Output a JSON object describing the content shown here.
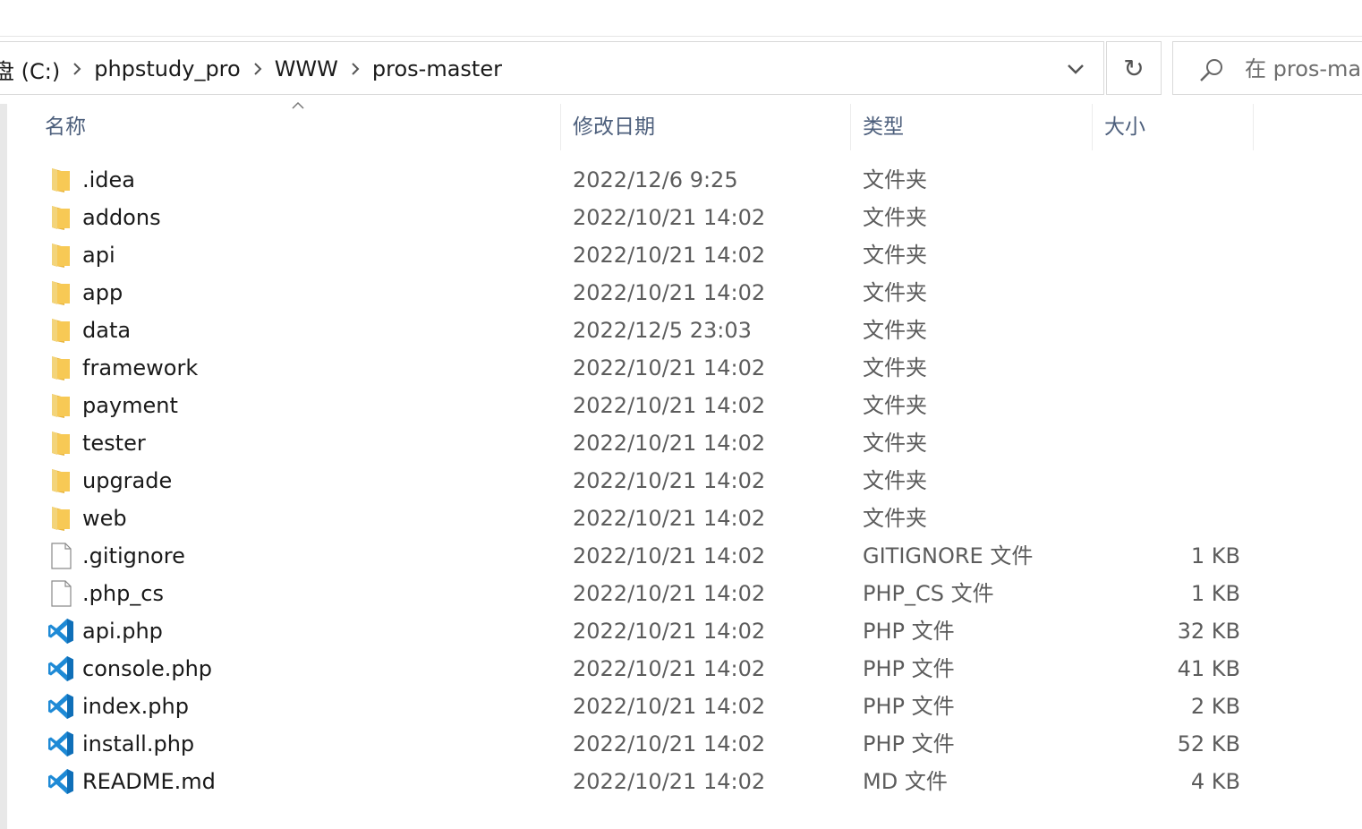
{
  "address": {
    "crumbs": [
      "盘 (C:)",
      "phpstudy_pro",
      "WWW",
      "pros-master"
    ],
    "dropdown_icon": "chevron-down-icon",
    "refresh_glyph": "↻"
  },
  "search": {
    "placeholder": "在 pros-master 中搜索"
  },
  "columns": {
    "name": "名称",
    "modified": "修改日期",
    "type": "类型",
    "size": "大小"
  },
  "colors": {
    "folder": "#f7c955",
    "vscode": "#1e8ad6",
    "header_text": "#4d5f7c"
  },
  "files": [
    {
      "name": ".idea",
      "modified": "2022/12/6 9:25",
      "type": "文件夹",
      "size": "",
      "icon": "folder-icon"
    },
    {
      "name": "addons",
      "modified": "2022/10/21 14:02",
      "type": "文件夹",
      "size": "",
      "icon": "folder-icon"
    },
    {
      "name": "api",
      "modified": "2022/10/21 14:02",
      "type": "文件夹",
      "size": "",
      "icon": "folder-icon"
    },
    {
      "name": "app",
      "modified": "2022/10/21 14:02",
      "type": "文件夹",
      "size": "",
      "icon": "folder-icon"
    },
    {
      "name": "data",
      "modified": "2022/12/5 23:03",
      "type": "文件夹",
      "size": "",
      "icon": "folder-icon"
    },
    {
      "name": "framework",
      "modified": "2022/10/21 14:02",
      "type": "文件夹",
      "size": "",
      "icon": "folder-icon"
    },
    {
      "name": "payment",
      "modified": "2022/10/21 14:02",
      "type": "文件夹",
      "size": "",
      "icon": "folder-icon"
    },
    {
      "name": "tester",
      "modified": "2022/10/21 14:02",
      "type": "文件夹",
      "size": "",
      "icon": "folder-icon"
    },
    {
      "name": "upgrade",
      "modified": "2022/10/21 14:02",
      "type": "文件夹",
      "size": "",
      "icon": "folder-icon"
    },
    {
      "name": "web",
      "modified": "2022/10/21 14:02",
      "type": "文件夹",
      "size": "",
      "icon": "folder-icon"
    },
    {
      "name": ".gitignore",
      "modified": "2022/10/21 14:02",
      "type": "GITIGNORE 文件",
      "size": "1 KB",
      "icon": "blank-file-icon"
    },
    {
      "name": ".php_cs",
      "modified": "2022/10/21 14:02",
      "type": "PHP_CS 文件",
      "size": "1 KB",
      "icon": "blank-file-icon"
    },
    {
      "name": "api.php",
      "modified": "2022/10/21 14:02",
      "type": "PHP 文件",
      "size": "32 KB",
      "icon": "vscode-file-icon"
    },
    {
      "name": "console.php",
      "modified": "2022/10/21 14:02",
      "type": "PHP 文件",
      "size": "41 KB",
      "icon": "vscode-file-icon"
    },
    {
      "name": "index.php",
      "modified": "2022/10/21 14:02",
      "type": "PHP 文件",
      "size": "2 KB",
      "icon": "vscode-file-icon"
    },
    {
      "name": "install.php",
      "modified": "2022/10/21 14:02",
      "type": "PHP 文件",
      "size": "52 KB",
      "icon": "vscode-file-icon"
    },
    {
      "name": "README.md",
      "modified": "2022/10/21 14:02",
      "type": "MD 文件",
      "size": "4 KB",
      "icon": "vscode-file-icon"
    }
  ]
}
